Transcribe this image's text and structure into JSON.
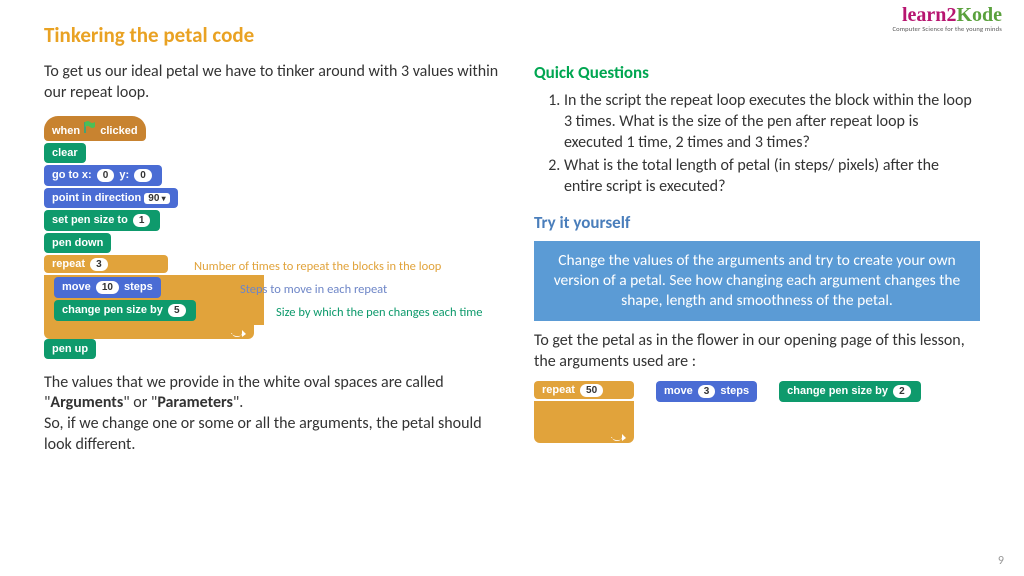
{
  "logo": {
    "main_a": "learn",
    "main_b": "2",
    "main_c": "Kode",
    "sub": "Computer Science for the young minds"
  },
  "title": "Tinkering the petal code",
  "left": {
    "intro": "To get us our ideal petal we have to tinker around with 3 values within our repeat loop.",
    "blocks": {
      "when": "when",
      "clicked": "clicked",
      "clear": "clear",
      "goto_a": "go to x:",
      "goto_x": "0",
      "goto_b": "y:",
      "goto_y": "0",
      "point": "point in direction",
      "point_v": "90",
      "setpen": "set pen size to",
      "setpen_v": "1",
      "pendown": "pen down",
      "repeat": "repeat",
      "repeat_v": "3",
      "move_a": "move",
      "move_v": "10",
      "move_b": "steps",
      "change": "change pen size by",
      "change_v": "5",
      "penup": "pen up"
    },
    "annot": {
      "a1": "Number of times to repeat the blocks in the loop",
      "a2": "Steps to move in each repeat",
      "a3": "Size by which the pen changes each time"
    },
    "expl_1": "The values that we provide in the white oval spaces are called \"",
    "expl_b1": "Arguments",
    "expl_2": "\" or \"",
    "expl_b2": "Parameters",
    "expl_3": "\".",
    "expl_4": "So, if we change one or some or all the arguments, the petal should look different."
  },
  "right": {
    "qq_title": "Quick Questions",
    "q1": "In the script the repeat loop executes the block within the loop 3 times. What is the size of the pen after repeat loop is executed 1 time, 2 times and 3 times?",
    "q2": "What is the total length of petal (in steps/ pixels) after the entire script is executed?",
    "tiy_title": "Try it yourself",
    "callout": "Change the values of the arguments and try to create your own version of a petal. See how changing each argument changes the shape, length and smoothness of the petal.",
    "usedargs": "To get the petal as in the flower in our opening page of this lesson, the arguments used are :",
    "args": {
      "repeat": "repeat",
      "repeat_v": "50",
      "move_a": "move",
      "move_v": "3",
      "move_b": "steps",
      "change": "change pen size by",
      "change_v": "2"
    }
  },
  "pagenum": "9"
}
